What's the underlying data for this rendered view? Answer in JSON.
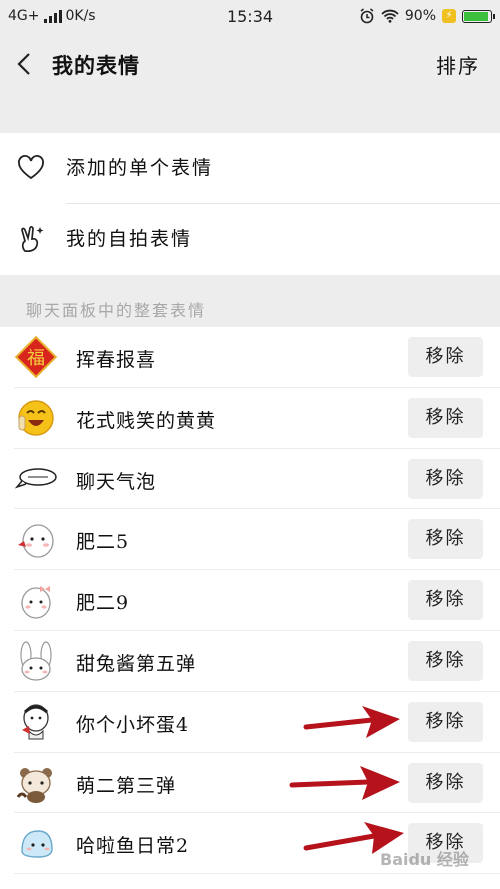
{
  "status": {
    "network": "4G+",
    "speed": "0K/s",
    "time": "15:34",
    "battery": "90%"
  },
  "header": {
    "title": "我的表情",
    "sort_label": "排序"
  },
  "top_items": [
    {
      "label": "添加的单个表情",
      "icon": "heart-icon"
    },
    {
      "label": "我的自拍表情",
      "icon": "peace-hand-icon"
    }
  ],
  "section_header": "聊天面板中的整套表情",
  "remove_label": "移除",
  "packs": [
    {
      "name": "挥春报喜",
      "icon": "fu-sticker-icon"
    },
    {
      "name": "花式贱笑的黄黄",
      "icon": "laughing-face-icon"
    },
    {
      "name": "聊天气泡",
      "icon": "speech-bubble-icon"
    },
    {
      "name": "肥二5",
      "icon": "chubby-bear-icon"
    },
    {
      "name": "肥二9",
      "icon": "chubby-bear-bow-icon"
    },
    {
      "name": "甜兔酱第五弹",
      "icon": "bunny-icon"
    },
    {
      "name": "你个小坏蛋4",
      "icon": "egg-kid-icon"
    },
    {
      "name": "萌二第三弹",
      "icon": "raccoon-icon"
    },
    {
      "name": "哈啦鱼日常2",
      "icon": "blue-fish-icon"
    }
  ],
  "watermark": "Baidu 经验"
}
